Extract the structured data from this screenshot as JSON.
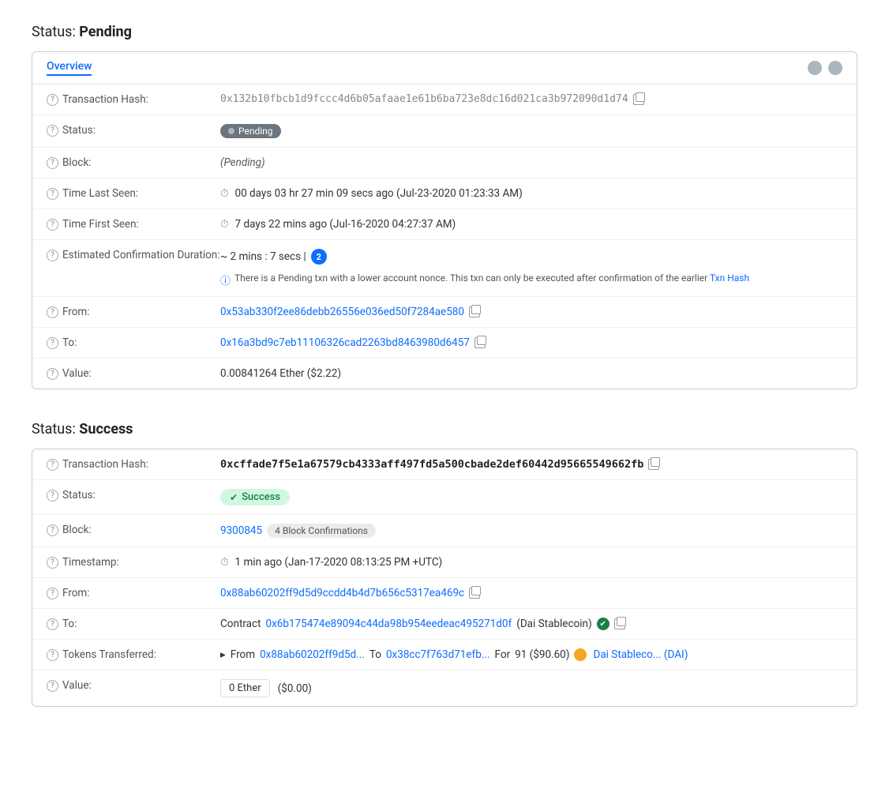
{
  "pending": {
    "section_title": "Status:",
    "section_status": "Pending",
    "tab_label": "Overview",
    "rows": {
      "tx_hash_label": "Transaction Hash:",
      "tx_hash_value": "0x132b10fbcb1d9fccc4d6b05afaae1e61b6ba723e8dc16d021ca3b972090d1d74",
      "status_label": "Status:",
      "status_value": "Pending",
      "block_label": "Block:",
      "block_value": "(Pending)",
      "time_last_seen_label": "Time Last Seen:",
      "time_last_seen_value": "00 days 03 hr 27 min 09 secs ago (Jul-23-2020 01:23:33 AM)",
      "time_first_seen_label": "Time First Seen:",
      "time_first_seen_value": "7 days 22 mins ago (Jul-16-2020 04:27:37 AM)",
      "est_confirmation_label": "Estimated Confirmation Duration:",
      "est_confirmation_value": "~ 2 mins : 7 secs |",
      "est_confirmation_note": "There is a Pending txn with a lower account nonce. This txn can only be executed after confirmation of the earlier Txn Hash",
      "from_label": "From:",
      "from_value": "0x53ab330f2ee86debb26556e036ed50f7284ae580",
      "to_label": "To:",
      "to_value": "0x16a3bd9c7eb11106326cad2263bd8463980d6457",
      "value_label": "Value:",
      "value_value": "0.00841264 Ether ($2.22)"
    }
  },
  "success": {
    "section_title": "Status:",
    "section_status": "Success",
    "rows": {
      "tx_hash_label": "Transaction Hash:",
      "tx_hash_value": "0xcffade7f5e1a67579cb4333aff497fd5a500cbade2def60442d95665549662fb",
      "status_label": "Status:",
      "status_value": "Success",
      "block_label": "Block:",
      "block_number": "9300845",
      "block_confirmations": "4 Block Confirmations",
      "timestamp_label": "Timestamp:",
      "timestamp_value": "1 min ago (Jan-17-2020 08:13:25 PM +UTC)",
      "from_label": "From:",
      "from_value": "0x88ab60202ff9d5d9ccdd4b4d7b656c5317ea469c",
      "to_label": "To:",
      "to_contract_prefix": "Contract",
      "to_contract_address": "0x6b175474e89094c44da98b954eedeac495271d0f",
      "to_contract_name": "(Dai Stablecoin)",
      "tokens_transferred_label": "Tokens Transferred:",
      "tokens_from_prefix": "From",
      "tokens_from_address": "0x88ab60202ff9d5d...",
      "tokens_to_prefix": "To",
      "tokens_to_address": "0x38cc7f763d71efb...",
      "tokens_for_prefix": "For",
      "tokens_amount": "91 ($90.60)",
      "tokens_name": "Dai Stableco... (DAI)",
      "value_label": "Value:",
      "value_ether": "0 Ether",
      "value_usd": "($0.00)"
    }
  }
}
